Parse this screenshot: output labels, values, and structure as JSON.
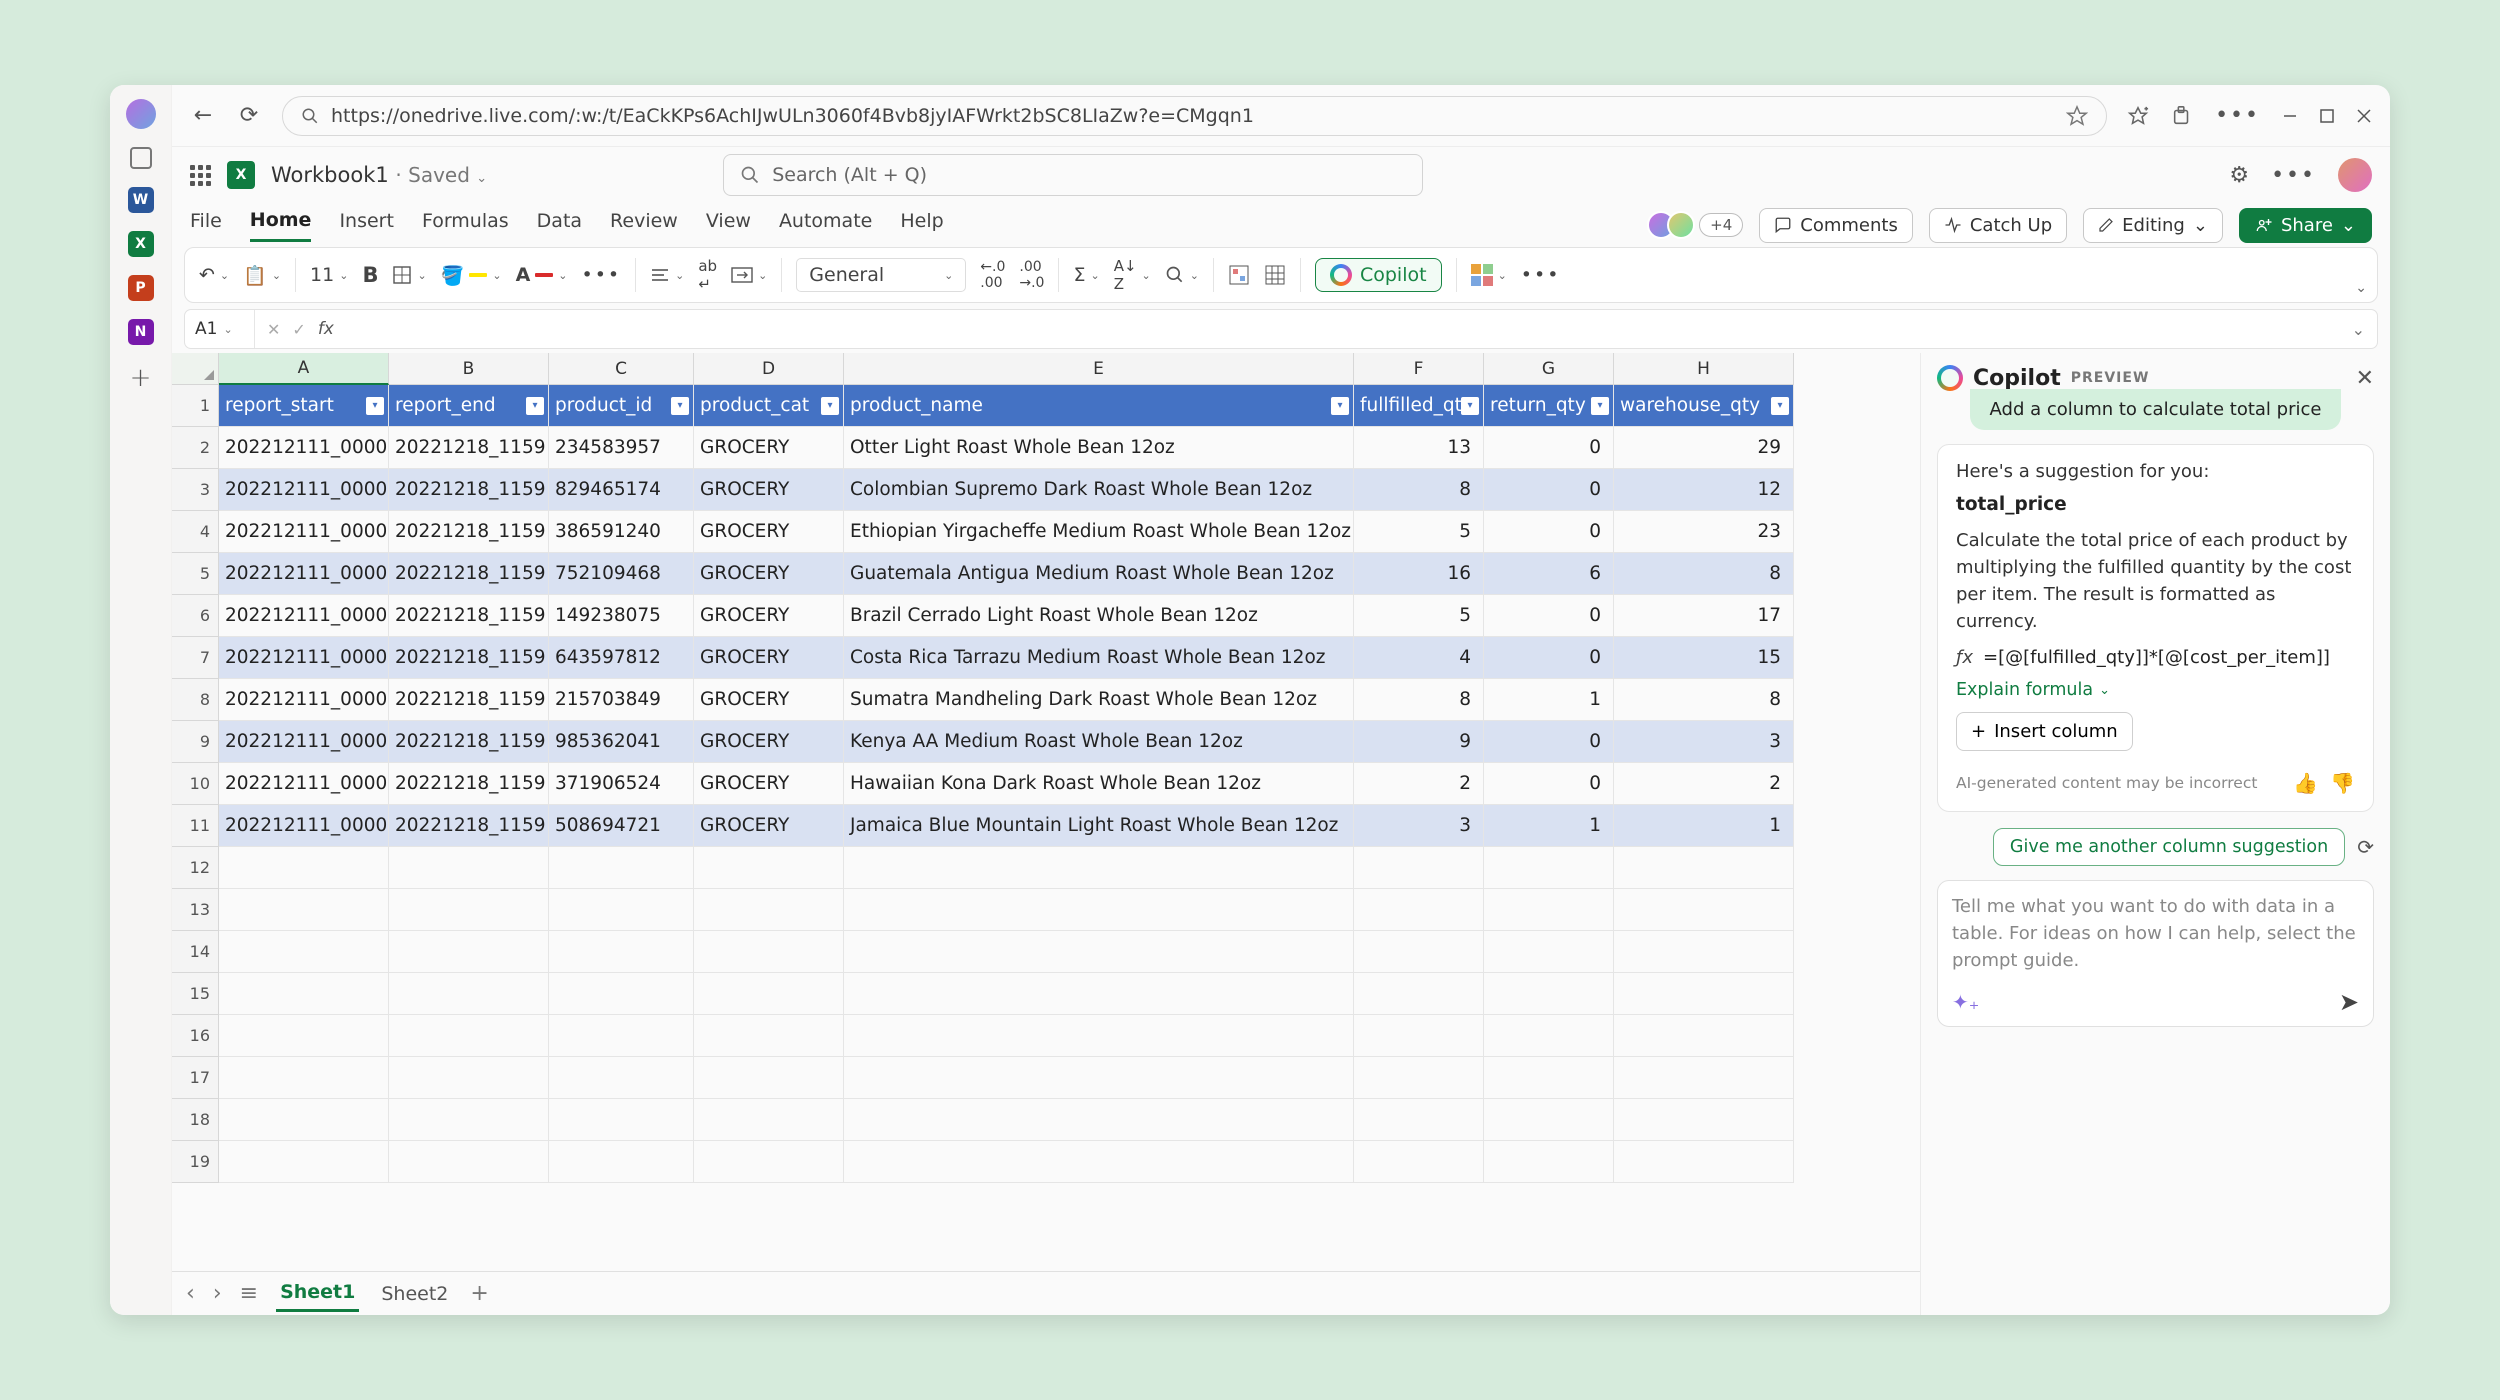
{
  "browser": {
    "url": "https://onedrive.live.com/:w:/t/EaCkKPs6AchIJwULn3060f4Bvb8jyIAFWrkt2bSC8LIaZw?e=CMgqn1"
  },
  "doc": {
    "title": "Workbook1",
    "state": "Saved"
  },
  "search": {
    "placeholder": "Search (Alt + Q)"
  },
  "ribbon": {
    "tabs": [
      "File",
      "Home",
      "Insert",
      "Formulas",
      "Data",
      "Review",
      "View",
      "Automate",
      "Help"
    ],
    "active": "Home",
    "presence_more": "+4",
    "comments": "Comments",
    "catchup": "Catch Up",
    "editing": "Editing",
    "share": "Share",
    "font_size": "11",
    "number_format": "General",
    "copilot": "Copilot"
  },
  "namebox": "A1",
  "columns": [
    "A",
    "B",
    "C",
    "D",
    "E",
    "F",
    "G",
    "H"
  ],
  "headers": [
    "report_start",
    "report_end",
    "product_id",
    "product_cat",
    "product_name",
    "fullfilled_qty",
    "return_qty",
    "warehouse_qty"
  ],
  "rows": [
    {
      "a": "202212111_0000",
      "b": "20221218_1159",
      "c": "234583957",
      "d": "GROCERY",
      "e": "Otter Light Roast Whole Bean 12oz",
      "f": "13",
      "g": "0",
      "h": "29"
    },
    {
      "a": "202212111_0000",
      "b": "20221218_1159",
      "c": "829465174",
      "d": "GROCERY",
      "e": "Colombian Supremo Dark Roast Whole Bean 12oz",
      "f": "8",
      "g": "0",
      "h": "12"
    },
    {
      "a": "202212111_0000",
      "b": "20221218_1159",
      "c": "386591240",
      "d": "GROCERY",
      "e": "Ethiopian Yirgacheffe Medium Roast Whole Bean 12oz",
      "f": "5",
      "g": "0",
      "h": "23"
    },
    {
      "a": "202212111_0000",
      "b": "20221218_1159",
      "c": "752109468",
      "d": "GROCERY",
      "e": "Guatemala Antigua Medium Roast Whole Bean 12oz",
      "f": "16",
      "g": "6",
      "h": "8"
    },
    {
      "a": "202212111_0000",
      "b": "20221218_1159",
      "c": "149238075",
      "d": "GROCERY",
      "e": "Brazil Cerrado Light Roast Whole Bean 12oz",
      "f": "5",
      "g": "0",
      "h": "17"
    },
    {
      "a": "202212111_0000",
      "b": "20221218_1159",
      "c": "643597812",
      "d": "GROCERY",
      "e": "Costa Rica Tarrazu Medium Roast Whole Bean 12oz",
      "f": "4",
      "g": "0",
      "h": "15"
    },
    {
      "a": "202212111_0000",
      "b": "20221218_1159",
      "c": "215703849",
      "d": "GROCERY",
      "e": "Sumatra Mandheling Dark Roast Whole Bean 12oz",
      "f": "8",
      "g": "1",
      "h": "8"
    },
    {
      "a": "202212111_0000",
      "b": "20221218_1159",
      "c": "985362041",
      "d": "GROCERY",
      "e": "Kenya AA Medium Roast Whole Bean 12oz",
      "f": "9",
      "g": "0",
      "h": "3"
    },
    {
      "a": "202212111_0000",
      "b": "20221218_1159",
      "c": "371906524",
      "d": "GROCERY",
      "e": "Hawaiian Kona Dark Roast Whole Bean 12oz",
      "f": "2",
      "g": "0",
      "h": "2"
    },
    {
      "a": "202212111_0000",
      "b": "20221218_1159",
      "c": "508694721",
      "d": "GROCERY",
      "e": "Jamaica Blue Mountain Light Roast Whole Bean 12oz",
      "f": "3",
      "g": "1",
      "h": "1"
    }
  ],
  "empty_rows": [
    "12",
    "13",
    "14",
    "15",
    "16",
    "17",
    "18",
    "19"
  ],
  "sheets": {
    "active": "Sheet1",
    "other": "Sheet2"
  },
  "copilot": {
    "title": "Copilot",
    "preview": "PREVIEW",
    "chip": "Add a column to calculate total price",
    "intro": "Here's a suggestion for you:",
    "col_name": "total_price",
    "desc": "Calculate the total price of each product by multiplying the fulfilled quantity by the cost per item. The result is formatted as currency.",
    "formula": "=[@[fulfilled_qty]]*[@[cost_per_item]]",
    "explain": "Explain formula",
    "insert": "Insert column",
    "disclaimer": "AI-generated content may be incorrect",
    "suggest": "Give me another column suggestion",
    "input_ph": "Tell me what you want to do with data in a table. For ideas on how I can help, select the prompt guide."
  }
}
